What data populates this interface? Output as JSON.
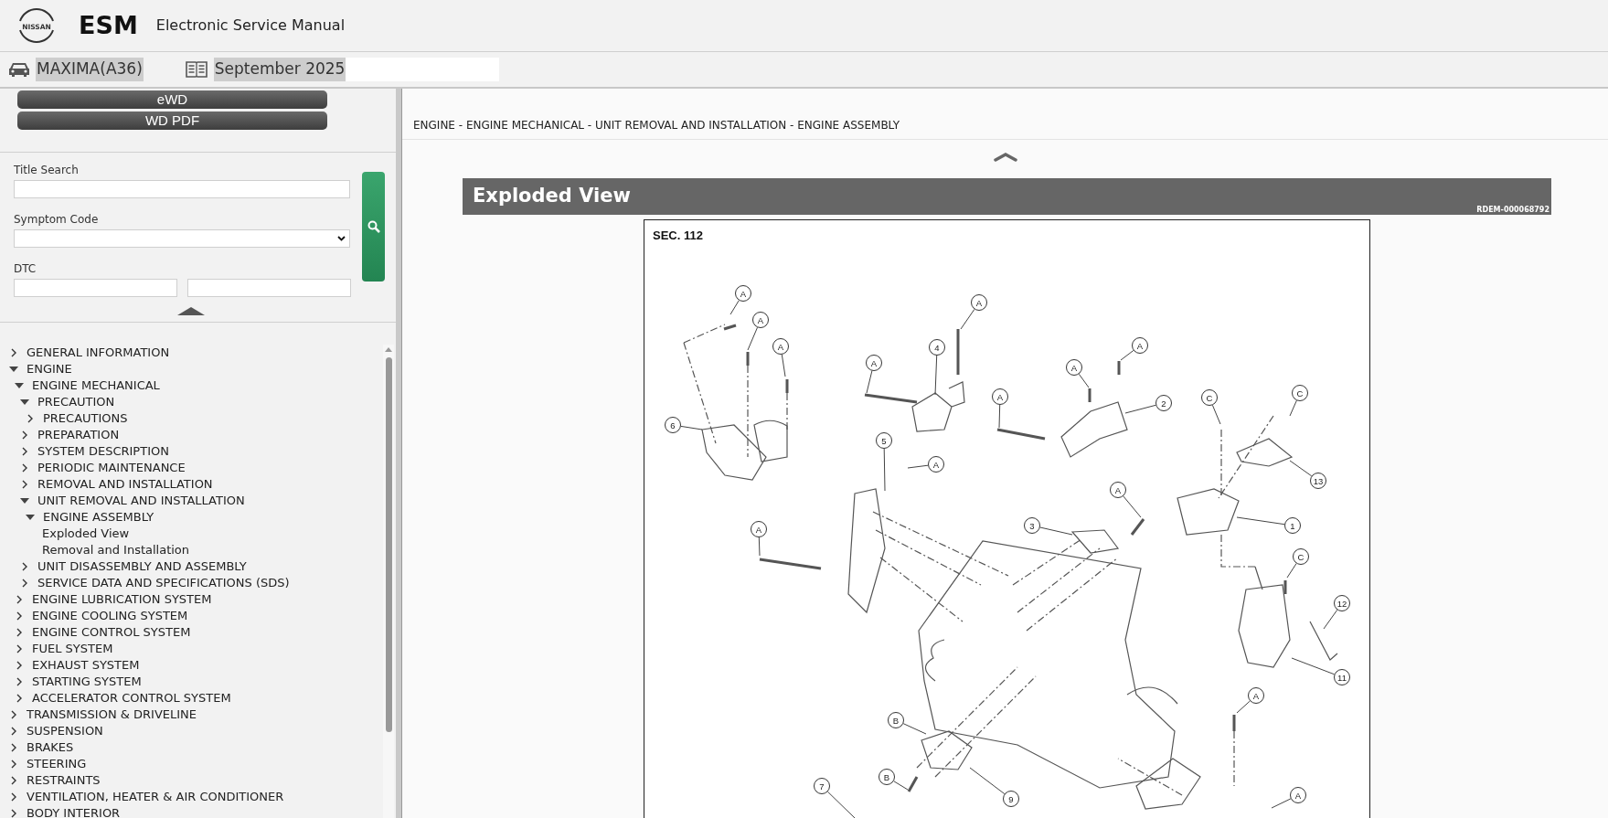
{
  "header": {
    "logo_text": "NISSAN",
    "app_code": "ESM",
    "app_title": "Electronic Service Manual"
  },
  "context_bar": {
    "model": "MAXIMA(A36)",
    "edition": "September 2025"
  },
  "sidebar": {
    "buttons": [
      "eWD",
      "WD PDF"
    ],
    "search": {
      "title_label": "Title Search",
      "symptom_label": "Symptom Code",
      "dtc_label": "DTC"
    },
    "tree": [
      {
        "label": "GENERAL INFORMATION",
        "kind": "folder",
        "expanded": false
      },
      {
        "label": "ENGINE",
        "kind": "folder",
        "expanded": true,
        "children": [
          {
            "label": "ENGINE MECHANICAL",
            "kind": "folder",
            "expanded": true,
            "children": [
              {
                "label": "PRECAUTION",
                "kind": "folder",
                "expanded": true,
                "children": [
                  {
                    "label": "PRECAUTIONS",
                    "kind": "folder",
                    "expanded": false
                  }
                ]
              },
              {
                "label": "PREPARATION",
                "kind": "folder",
                "expanded": false
              },
              {
                "label": "SYSTEM DESCRIPTION",
                "kind": "folder",
                "expanded": false
              },
              {
                "label": "PERIODIC MAINTENANCE",
                "kind": "folder",
                "expanded": false
              },
              {
                "label": "REMOVAL AND INSTALLATION",
                "kind": "folder",
                "expanded": false
              },
              {
                "label": "UNIT REMOVAL AND INSTALLATION",
                "kind": "folder",
                "expanded": true,
                "children": [
                  {
                    "label": "ENGINE ASSEMBLY",
                    "kind": "folder",
                    "expanded": true,
                    "children": [
                      {
                        "label": "Exploded View",
                        "kind": "page"
                      },
                      {
                        "label": "Removal and Installation",
                        "kind": "page"
                      }
                    ]
                  }
                ]
              },
              {
                "label": "UNIT DISASSEMBLY AND ASSEMBLY",
                "kind": "folder",
                "expanded": false
              },
              {
                "label": "SERVICE DATA AND SPECIFICATIONS (SDS)",
                "kind": "folder",
                "expanded": false
              }
            ]
          },
          {
            "label": "ENGINE LUBRICATION SYSTEM",
            "kind": "folder",
            "expanded": false
          },
          {
            "label": "ENGINE COOLING SYSTEM",
            "kind": "folder",
            "expanded": false
          },
          {
            "label": "ENGINE CONTROL SYSTEM",
            "kind": "folder",
            "expanded": false
          },
          {
            "label": "FUEL SYSTEM",
            "kind": "folder",
            "expanded": false
          },
          {
            "label": "EXHAUST SYSTEM",
            "kind": "folder",
            "expanded": false
          },
          {
            "label": "STARTING SYSTEM",
            "kind": "folder",
            "expanded": false
          },
          {
            "label": "ACCELERATOR CONTROL SYSTEM",
            "kind": "folder",
            "expanded": false
          }
        ]
      },
      {
        "label": "TRANSMISSION & DRIVELINE",
        "kind": "folder",
        "expanded": false
      },
      {
        "label": "SUSPENSION",
        "kind": "folder",
        "expanded": false
      },
      {
        "label": "BRAKES",
        "kind": "folder",
        "expanded": false
      },
      {
        "label": "STEERING",
        "kind": "folder",
        "expanded": false
      },
      {
        "label": "RESTRAINTS",
        "kind": "folder",
        "expanded": false
      },
      {
        "label": "VENTILATION, HEATER & AIR CONDITIONER",
        "kind": "folder",
        "expanded": false
      },
      {
        "label": "BODY INTERIOR",
        "kind": "folder",
        "expanded": false
      }
    ]
  },
  "content": {
    "breadcrumb": "ENGINE - ENGINE MECHANICAL - UNIT REMOVAL AND INSTALLATION - ENGINE ASSEMBLY",
    "section_title": "Exploded View",
    "doc_id": "RDEM-000068792",
    "figure": {
      "section": "SEC. 112",
      "callouts": [
        "A",
        "A",
        "A",
        "6",
        "4",
        "A",
        "A",
        "A",
        "A",
        "A",
        "2",
        "C",
        "C",
        "13",
        "5",
        "A",
        "A",
        "3",
        "1",
        "A",
        "C",
        "12",
        "11",
        "A",
        "B",
        "B",
        "9",
        "7",
        "A"
      ]
    }
  }
}
